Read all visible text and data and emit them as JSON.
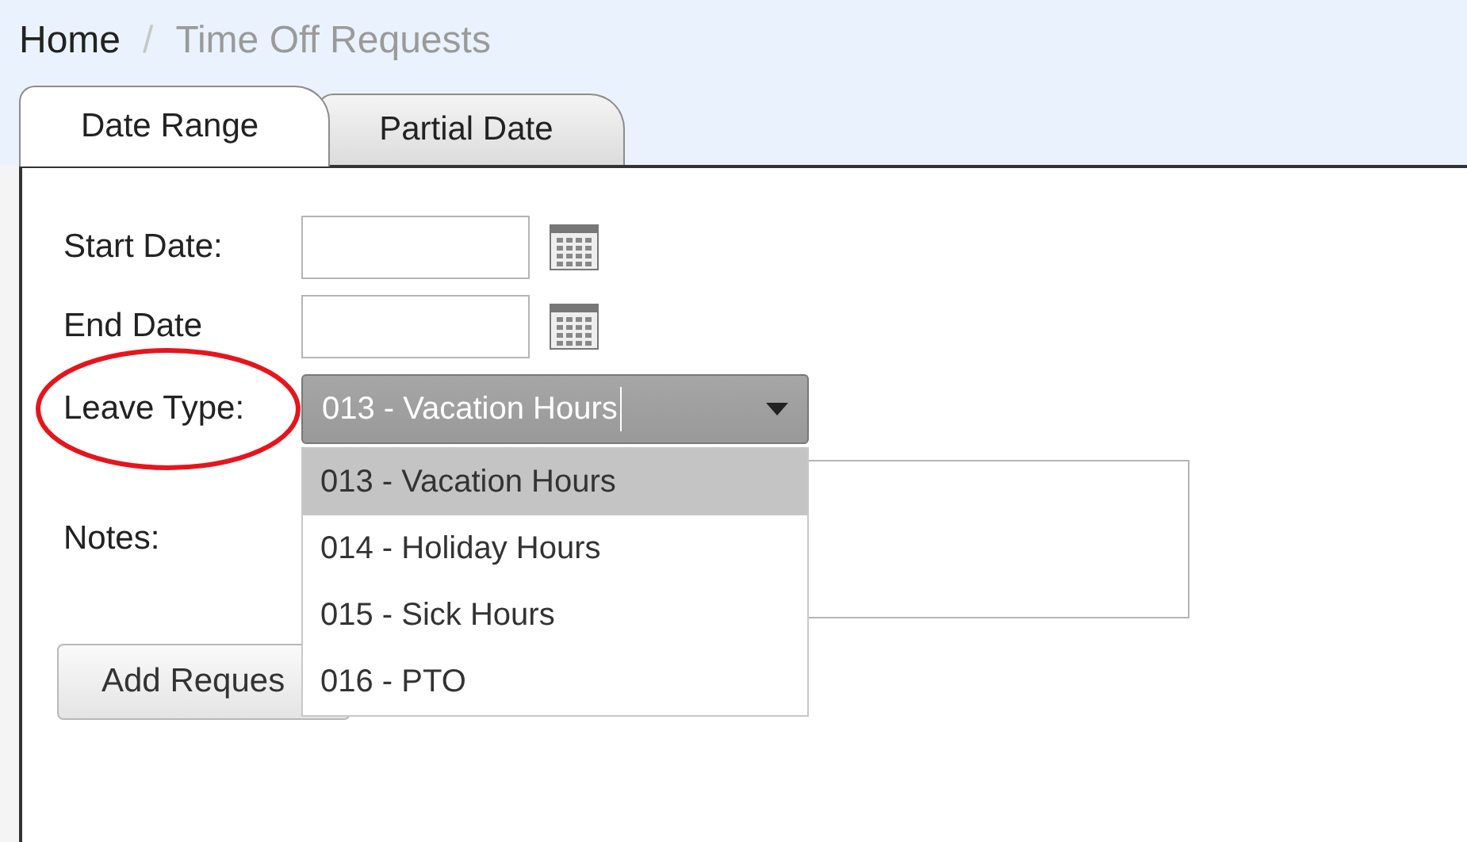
{
  "breadcrumb": [
    {
      "label": "Home",
      "current": false
    },
    {
      "label": "/",
      "kind": "separator"
    },
    {
      "label": "Time Off Requests",
      "current": true
    }
  ],
  "tabs": [
    {
      "label": "Date Range",
      "selected": true
    },
    {
      "label": "Partial Date",
      "selected": false
    }
  ],
  "form": {
    "start_date": {
      "label": "Start Date:"
    },
    "end_date": {
      "label": "End Date"
    },
    "leave_type": {
      "label": "Leave Type:",
      "value": "013 - Vacation Hours",
      "expanded": true,
      "options": [
        {
          "label": "013 - Vacation Hours",
          "selected": true
        },
        {
          "label": "014 - Holiday Hours",
          "selected": false
        },
        {
          "label": "015 - Sick Hours",
          "selected": false
        },
        {
          "label": "016 - PTO",
          "selected": false
        }
      ]
    },
    "notes": {
      "label": "Notes:"
    },
    "submit_button": "Add Reques"
  },
  "annotation": {
    "kind": "ellipse"
  }
}
